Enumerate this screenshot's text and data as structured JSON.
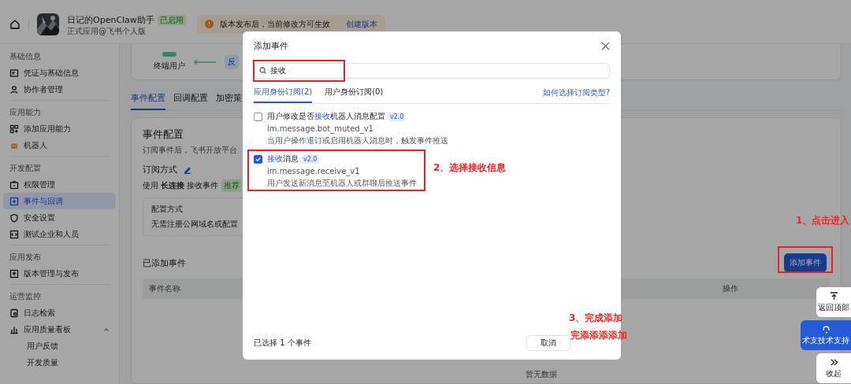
{
  "header": {
    "app_name": "日记的OpenClaw助手",
    "status_badge": "已启用",
    "subtitle": "正式应用@飞书个人版",
    "notice": "版本发布后，当前修改方可生效",
    "notice_link": "创建版本"
  },
  "sidebar": {
    "sections": [
      {
        "title": "基础信息",
        "items": [
          {
            "label": "凭证与基础信息",
            "selected": false
          },
          {
            "label": "协作者管理",
            "selected": false
          }
        ]
      },
      {
        "title": "应用能力",
        "items": [
          {
            "label": "添加应用能力",
            "selected": false
          },
          {
            "label": "机器人",
            "selected": false
          }
        ]
      },
      {
        "title": "开发配置",
        "items": [
          {
            "label": "权限管理",
            "selected": false
          },
          {
            "label": "事件与回调",
            "selected": true
          },
          {
            "label": "安全设置",
            "selected": false
          },
          {
            "label": "测试企业和人员",
            "selected": false
          }
        ]
      },
      {
        "title": "应用发布",
        "items": [
          {
            "label": "版本管理与发布",
            "selected": false
          }
        ]
      },
      {
        "title": "运营监控",
        "items": [
          {
            "label": "日志检索",
            "selected": false
          },
          {
            "label": "应用质量看板",
            "selected": false,
            "expanded": true,
            "children": [
              {
                "label": "用户反馈",
                "selected": false
              },
              {
                "label": "开发质量",
                "selected": false
              }
            ]
          }
        ]
      }
    ]
  },
  "flow": {
    "node_label": "终端用户",
    "arrow_label": "反"
  },
  "tabs": [
    {
      "label": "事件配置",
      "selected": true
    },
    {
      "label": "回调配置",
      "selected": false
    },
    {
      "label": "加密策",
      "selected": false
    }
  ],
  "event_config": {
    "title": "事件配置",
    "description": "订阅事件后，飞书开放平台",
    "subscription_title": "订阅方式",
    "mode_prefix": "使用",
    "mode": "长连接",
    "mode_suffix": "接收事件",
    "mode_badge": "推荐",
    "config_label": "配置方式",
    "config_text": "无需注册公网域名或配置"
  },
  "added_events": {
    "title": "已添加事件",
    "add_button": "添加事件",
    "columns": [
      "事件名称",
      "操作"
    ],
    "empty": "暂无数据"
  },
  "float_buttons": [
    {
      "kind": "top",
      "label": "返回顶部"
    },
    {
      "kind": "support",
      "label": "术支技术支持"
    },
    {
      "kind": "collapse",
      "label": "收起"
    }
  ],
  "modal": {
    "title": "添加事件",
    "search_value": "接收",
    "tabs": [
      {
        "label": "应用身份订阅(2)",
        "selected": true
      },
      {
        "label": "用户身份订阅(0)",
        "selected": false
      }
    ],
    "help_link": "如何选择订阅类型?",
    "events": [
      {
        "name": [
          {
            "text": "用户修改是否",
            "highlight": false
          },
          {
            "text": "接收",
            "highlight": true
          },
          {
            "text": "机器人消息配置",
            "highlight": false
          }
        ],
        "version": "v2.0",
        "code": "im.message.bot_muted_v1",
        "description": "当用户操作退订或启用机器人消息时，触发事件推送",
        "checked": false
      },
      {
        "name": [
          {
            "text": "接收",
            "highlight": true
          },
          {
            "text": "消息",
            "highlight": false
          }
        ],
        "version": "v2.0",
        "code": "im.message.receive_v1",
        "description": "用户发送新消息至机器人或群聊后推送事件",
        "checked": true
      }
    ],
    "selected_count": "已选择 1 个事件",
    "cancel_button": "取消"
  },
  "annotations": [
    {
      "kind": "box"
    },
    {
      "kind": "box"
    },
    {
      "kind": "box"
    },
    {
      "kind": "text",
      "text": "2、选择接收信息"
    },
    {
      "kind": "text",
      "text": "1、点击进入"
    },
    {
      "kind": "text",
      "text": "3、完成添加"
    },
    {
      "kind": "text",
      "text": "完添添添添加"
    }
  ]
}
